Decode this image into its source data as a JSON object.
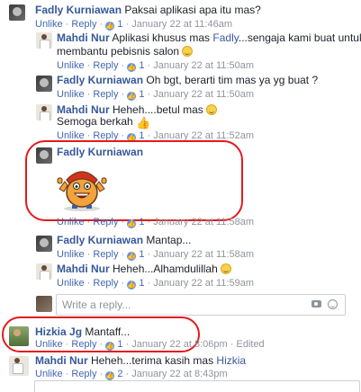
{
  "comments": [
    {
      "name": "Fadly Kurniawan",
      "text": "Paksai aplikasi apa itu mas?",
      "likes": "1",
      "time": "January 22 at 11:46am"
    },
    {
      "name": "Mahdi Nur",
      "text": "Aplikasi khusus mas",
      "mention": "Fadly",
      "text2": "...sengaja kami buat untuk",
      "text3": "membantu pebisnis salon",
      "likes": "1",
      "time": "January 22 at 11:50am"
    },
    {
      "name": "Fadly Kurniawan",
      "text": "Oh bgt, berarti tim mas ya yg buat ?",
      "likes": "1",
      "time": "January 22 at 11:50am"
    },
    {
      "name": "Mahdi Nur",
      "text": "Heheh....betul mas",
      "text2": "Semoga berkah",
      "likes": "1",
      "time": "January 22 at 11:52am"
    },
    {
      "name": "Fadly Kurniawan",
      "likes": "1",
      "time": "January 22 at 11:58am"
    },
    {
      "name": "Fadly Kurniawan",
      "text": "Mantap...",
      "likes": "1",
      "time": "January 22 at 11:58am"
    },
    {
      "name": "Mahdi Nur",
      "text": "Heheh...Alhamdulillah",
      "likes": "1",
      "time": "January 22 at 11:59am"
    },
    {
      "name": "Hizkia Jg",
      "text": "Mantaff...",
      "likes": "1",
      "time": "January 22 at 8:06pm",
      "edited": "Edited"
    },
    {
      "name": "Mahdi Nur",
      "text": "Heheh...terima kasih mas",
      "mention": "Hizkia",
      "likes": "2",
      "time": "January 22 at 8:43pm"
    }
  ],
  "actions": {
    "unlike": "Unlike",
    "reply": "Reply",
    "dot": "·"
  },
  "reply_box": {
    "placeholder": "Write a reply..."
  },
  "icons": {
    "like": "like-badge-icon",
    "smile": "smile-emoji-icon",
    "thumb": "thumbs-up-emoji-icon",
    "camera": "camera-icon",
    "emoji": "emoji-icon"
  },
  "colors": {
    "link": "#4267b2",
    "name": "#365899",
    "meta": "#90949c",
    "highlight": "#e21b1b",
    "like_badge": "#5890ff"
  }
}
